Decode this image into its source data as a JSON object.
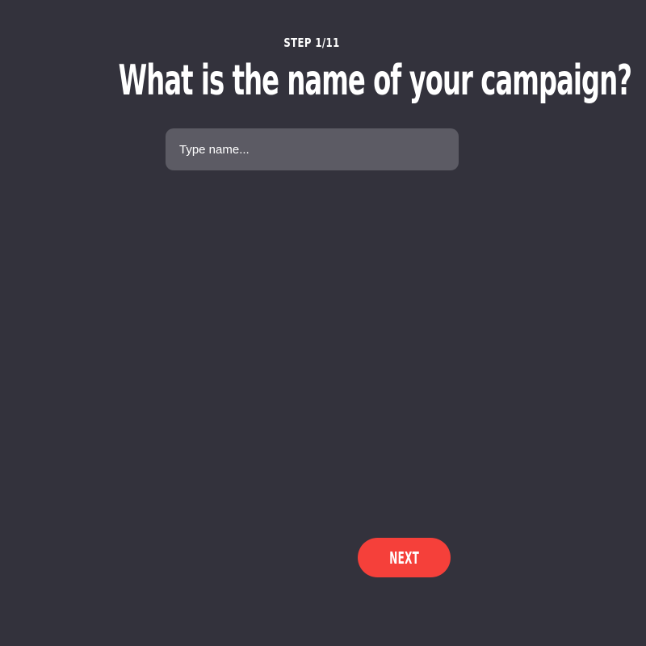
{
  "wizard": {
    "step_label": "STEP 1/11",
    "question": "What is the name of your campaign?",
    "name_input": {
      "placeholder": "Type name...",
      "value": ""
    },
    "next_label": "NEXT"
  },
  "colors": {
    "background": "#33323c",
    "input_background": "#5c5b64",
    "accent": "#f5403a",
    "text": "#ffffff"
  }
}
